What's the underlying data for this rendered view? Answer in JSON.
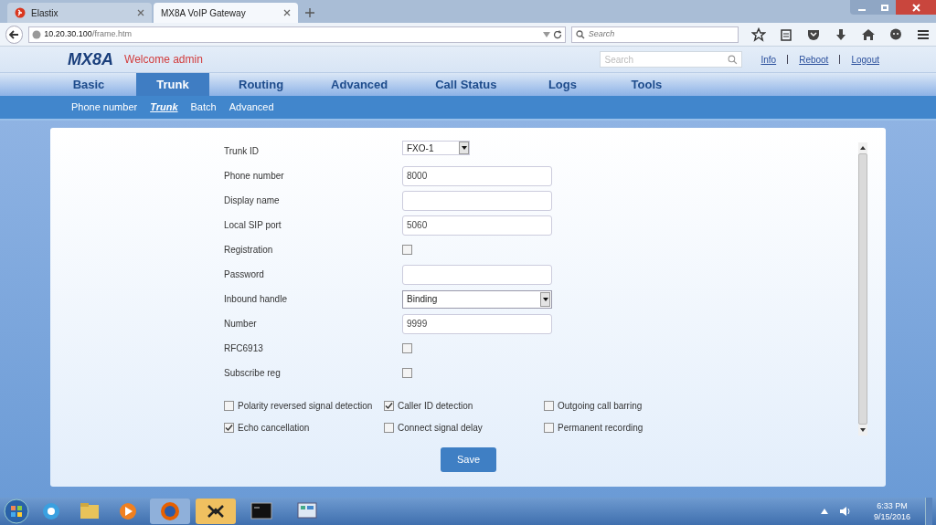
{
  "browser": {
    "tabs": [
      {
        "title": "Elastix",
        "selected": false
      },
      {
        "title": "MX8A VoIP Gateway",
        "selected": true
      }
    ],
    "url_host": "10.20.30.100",
    "url_path": "/frame.htm",
    "search_placeholder": "Search"
  },
  "header": {
    "logo": "MX8A",
    "welcome": "Welcome admin",
    "search_placeholder": "Search",
    "links": [
      "Info",
      "Reboot",
      "Logout"
    ]
  },
  "main_nav": [
    {
      "label": "Basic",
      "selected": false
    },
    {
      "label": "Trunk",
      "selected": true
    },
    {
      "label": "Routing",
      "selected": false
    },
    {
      "label": "Advanced",
      "selected": false
    },
    {
      "label": "Call Status",
      "selected": false
    },
    {
      "label": "Logs",
      "selected": false
    },
    {
      "label": "Tools",
      "selected": false
    }
  ],
  "sub_nav": [
    {
      "label": "Phone number",
      "selected": false
    },
    {
      "label": "Trunk",
      "selected": true
    },
    {
      "label": "Batch",
      "selected": false
    },
    {
      "label": "Advanced",
      "selected": false
    }
  ],
  "form": {
    "fields": [
      {
        "label": "Trunk ID",
        "kind": "short_select",
        "value": "FXO-1"
      },
      {
        "label": "Phone number",
        "kind": "text",
        "value": "8000"
      },
      {
        "label": "Display name",
        "kind": "text"
      },
      {
        "label": "Local SIP port",
        "kind": "text",
        "value": "5060"
      },
      {
        "label": "Registration",
        "kind": "checkbox",
        "checked": false
      },
      {
        "label": "Password",
        "kind": "text"
      },
      {
        "label": "Inbound handle",
        "kind": "select",
        "value": "Binding"
      },
      {
        "label": "Number",
        "kind": "text",
        "value": "9999"
      },
      {
        "label": "RFC6913",
        "kind": "checkbox",
        "checked": false
      },
      {
        "label": "Subscribe reg",
        "kind": "checkbox",
        "checked": false
      }
    ],
    "options": [
      {
        "label": "Polarity reversed signal detection",
        "checked": false
      },
      {
        "label": "Caller ID detection",
        "checked": true
      },
      {
        "label": "Outgoing call barring",
        "checked": false
      },
      {
        "label": "Echo cancellation",
        "checked": true
      },
      {
        "label": "Connect signal delay",
        "checked": false
      },
      {
        "label": "Permanent recording",
        "checked": false
      }
    ],
    "save": "Save"
  },
  "taskbar": {
    "time": "6:33 PM",
    "date": "9/15/2016"
  }
}
